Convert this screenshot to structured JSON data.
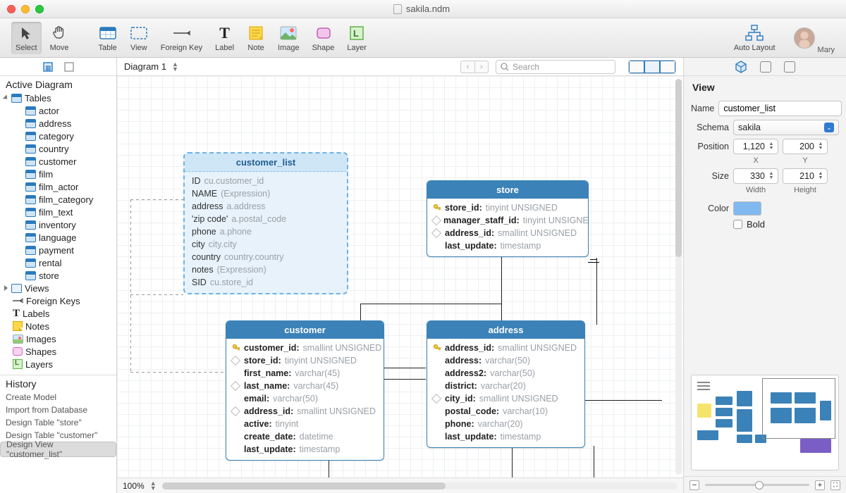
{
  "window": {
    "title": "sakila.ndm"
  },
  "user": {
    "name": "Mary"
  },
  "toolbar": {
    "select": "Select",
    "move": "Move",
    "table": "Table",
    "view": "View",
    "foreign_key": "Foreign Key",
    "label": "Label",
    "note": "Note",
    "image": "Image",
    "shape": "Shape",
    "layer": "Layer",
    "auto_layout": "Auto Layout"
  },
  "sidebar": {
    "active_diagram": "Active Diagram",
    "tables_label": "Tables",
    "tables": [
      "actor",
      "address",
      "category",
      "country",
      "customer",
      "film",
      "film_actor",
      "film_category",
      "film_text",
      "inventory",
      "language",
      "payment",
      "rental",
      "store"
    ],
    "views_label": "Views",
    "foreign_keys": "Foreign Keys",
    "labels": "Labels",
    "notes": "Notes",
    "images": "Images",
    "shapes": "Shapes",
    "layers": "Layers",
    "history_label": "History",
    "history": [
      "Create Model",
      "Import from Database",
      "Design Table \"store\"",
      "Design Table \"customer\"",
      "Design View \"customer_list\""
    ]
  },
  "docbar": {
    "diagram": "Diagram 1",
    "search_placeholder": "Search"
  },
  "zoom": {
    "percent": "100%"
  },
  "entities": {
    "customer_list": {
      "title": "customer_list",
      "rows": [
        {
          "n": "ID",
          "t": "cu.customer_id"
        },
        {
          "n": "NAME",
          "t": "(Expression)"
        },
        {
          "n": "address",
          "t": "a.address"
        },
        {
          "n": "'zip code'",
          "t": "a.postal_code"
        },
        {
          "n": "phone",
          "t": "a.phone"
        },
        {
          "n": "city",
          "t": "city.city"
        },
        {
          "n": "country",
          "t": "country.country"
        },
        {
          "n": "notes",
          "t": "(Expression)"
        },
        {
          "n": "SID",
          "t": "cu.store_id"
        }
      ]
    },
    "store": {
      "title": "store",
      "rows": [
        {
          "ic": "pk",
          "n": "store_id:",
          "t": "tinyint UNSIGNED"
        },
        {
          "ic": "d",
          "n": "manager_staff_id:",
          "t": "tinyint UNSIGNED"
        },
        {
          "ic": "d",
          "n": "address_id:",
          "t": "smallint UNSIGNED"
        },
        {
          "ic": "",
          "n": "last_update:",
          "t": "timestamp"
        }
      ]
    },
    "customer": {
      "title": "customer",
      "rows": [
        {
          "ic": "pk",
          "n": "customer_id:",
          "t": "smallint UNSIGNED"
        },
        {
          "ic": "d",
          "n": "store_id:",
          "t": "tinyint UNSIGNED"
        },
        {
          "ic": "",
          "n": "first_name:",
          "t": "varchar(45)"
        },
        {
          "ic": "d",
          "n": "last_name:",
          "t": "varchar(45)"
        },
        {
          "ic": "",
          "n": "email:",
          "t": "varchar(50)"
        },
        {
          "ic": "d",
          "n": "address_id:",
          "t": "smallint UNSIGNED"
        },
        {
          "ic": "",
          "n": "active:",
          "t": "tinyint"
        },
        {
          "ic": "",
          "n": "create_date:",
          "t": "datetime"
        },
        {
          "ic": "",
          "n": "last_update:",
          "t": "timestamp"
        }
      ]
    },
    "address": {
      "title": "address",
      "rows": [
        {
          "ic": "pk",
          "n": "address_id:",
          "t": "smallint UNSIGNED"
        },
        {
          "ic": "",
          "n": "address:",
          "t": "varchar(50)"
        },
        {
          "ic": "",
          "n": "address2:",
          "t": "varchar(50)"
        },
        {
          "ic": "",
          "n": "district:",
          "t": "varchar(20)"
        },
        {
          "ic": "d",
          "n": "city_id:",
          "t": "smallint UNSIGNED"
        },
        {
          "ic": "",
          "n": "postal_code:",
          "t": "varchar(10)"
        },
        {
          "ic": "",
          "n": "phone:",
          "t": "varchar(20)"
        },
        {
          "ic": "",
          "n": "last_update:",
          "t": "timestamp"
        }
      ]
    }
  },
  "inspector": {
    "heading": "View",
    "name_label": "Name",
    "name_value": "customer_list",
    "schema_label": "Schema",
    "schema_value": "sakila",
    "position_label": "Position",
    "pos_x": "1,120",
    "pos_y": "200",
    "x_label": "X",
    "y_label": "Y",
    "size_label": "Size",
    "size_w": "330",
    "size_h": "210",
    "w_label": "Width",
    "h_label": "Height",
    "color_label": "Color",
    "bold_label": "Bold"
  }
}
